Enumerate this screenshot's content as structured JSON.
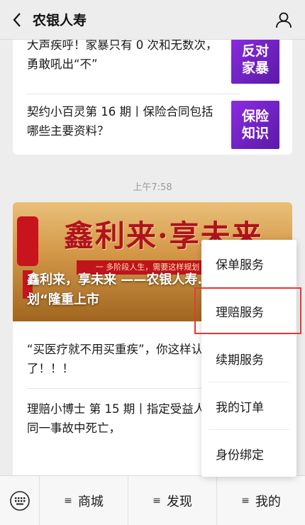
{
  "header": {
    "title": "农银人寿"
  },
  "feed": {
    "card1": {
      "articles": [
        {
          "title": "大声疾呼！家暴只有 0 次和无数次，勇敢吼出“不”",
          "thumb": "反对家暴"
        },
        {
          "title": "契约小百灵第 16 期丨保险合同包括哪些主要资料？",
          "thumb": "保险知识"
        }
      ]
    },
    "timestamp": "上午7:58",
    "card2": {
      "banner_big": "鑫利来·享未来",
      "banner_strip": "一 多阶段人生，需要这样规划",
      "banner_title": "鑫利来，享未来 ——农银人寿...险产品计划“隆重上市",
      "articles": [
        {
          "title": "“买医疗就不用买重疾”，你这样认为就大错特错了！！！"
        },
        {
          "title": "理赔小博士 第 15 期丨指定受益人与被保险人在同一事故中死亡，"
        }
      ]
    }
  },
  "menu": {
    "items": [
      "保单服务",
      "理赔服务",
      "续期服务",
      "我的订单",
      "身份绑定"
    ],
    "highlighted": "理赔服务"
  },
  "bottom_bar": {
    "tabs": [
      "商城",
      "发现",
      "我的"
    ]
  },
  "colors": {
    "highlight": "#e53935",
    "thumb": "#7b22c9",
    "banner_red": "#b0121b"
  }
}
